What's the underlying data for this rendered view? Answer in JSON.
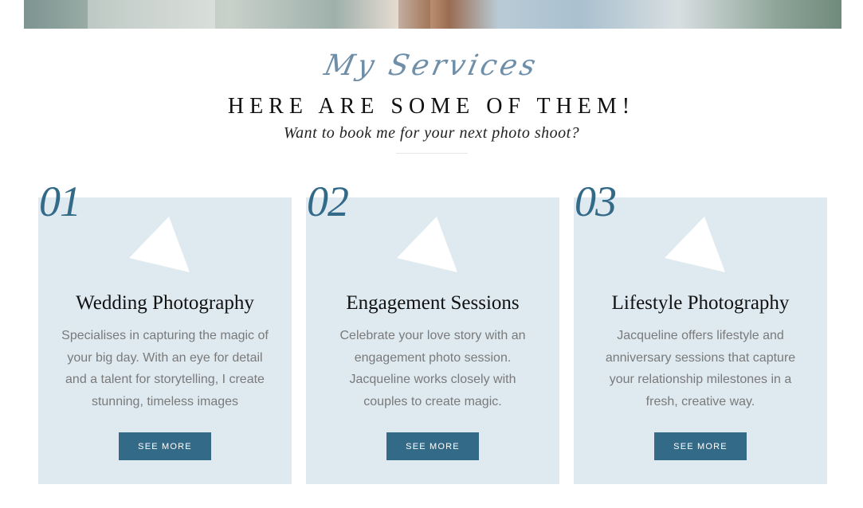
{
  "section": {
    "script_title": "My Services",
    "heading": "HERE ARE SOME OF THEM!",
    "subheading": "Want to book me for your next photo shoot?"
  },
  "cards": [
    {
      "number": "01",
      "title": "Wedding Photography",
      "text": "Specialises in capturing the magic of your big day. With an eye for detail and a talent for storytelling, I create stunning, timeless images",
      "button": "SEE MORE"
    },
    {
      "number": "02",
      "title": "Engagement Sessions",
      "text": "Celebrate your love story with an engagement photo session. Jacqueline works closely with couples to create magic.",
      "button": "SEE MORE"
    },
    {
      "number": "03",
      "title": "Lifestyle Photography",
      "text": "Jacqueline offers lifestyle and anniversary sessions that capture your relationship milestones in a fresh, creative way.",
      "button": "SEE MORE"
    }
  ],
  "colors": {
    "accent": "#336a88",
    "card_bg": "#deeaf0",
    "script": "#6f8ea8"
  },
  "icons": [
    "triangle-icon"
  ]
}
